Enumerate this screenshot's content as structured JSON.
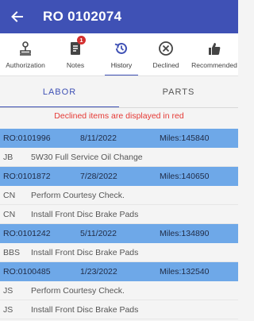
{
  "appbar": {
    "back_icon": "arrow-back-icon",
    "title": "RO 0102074",
    "color": "#3f51b5"
  },
  "toolbar": {
    "items": [
      {
        "label": "Authorization",
        "icon": "stamp-icon"
      },
      {
        "label": "Notes",
        "icon": "notes-icon",
        "badge": "1"
      },
      {
        "label": "History",
        "icon": "history-icon",
        "active": true
      },
      {
        "label": "Declined",
        "icon": "close-circle-icon"
      },
      {
        "label": "Recommended",
        "icon": "thumbs-up-icon"
      }
    ]
  },
  "tabs": [
    {
      "label": "LABOR",
      "active": true
    },
    {
      "label": "PARTS",
      "active": false
    }
  ],
  "notice": {
    "text": "Declined items are displayed in red",
    "color": "#e53935"
  },
  "history": [
    {
      "ro": "RO:0101996",
      "date": "8/11/2022",
      "miles": "Miles:145840",
      "items": [
        {
          "tech": "JB",
          "desc": "5W30 Full Service Oil Change"
        }
      ]
    },
    {
      "ro": "RO:0101872",
      "date": "7/28/2022",
      "miles": "Miles:140650",
      "items": [
        {
          "tech": "CN",
          "desc": "Perform Courtesy Check."
        },
        {
          "tech": "CN",
          "desc": "Install Front Disc Brake Pads"
        }
      ]
    },
    {
      "ro": "RO:0101242",
      "date": "5/11/2022",
      "miles": "Miles:134890",
      "items": [
        {
          "tech": "BBS",
          "desc": "Install Front Disc Brake Pads"
        }
      ]
    },
    {
      "ro": "RO:0100485",
      "date": "1/23/2022",
      "miles": "Miles:132540",
      "items": [
        {
          "tech": "JS",
          "desc": "Perform Courtesy Check."
        },
        {
          "tech": "JS",
          "desc": "Install Front Disc Brake Pads"
        }
      ]
    }
  ]
}
